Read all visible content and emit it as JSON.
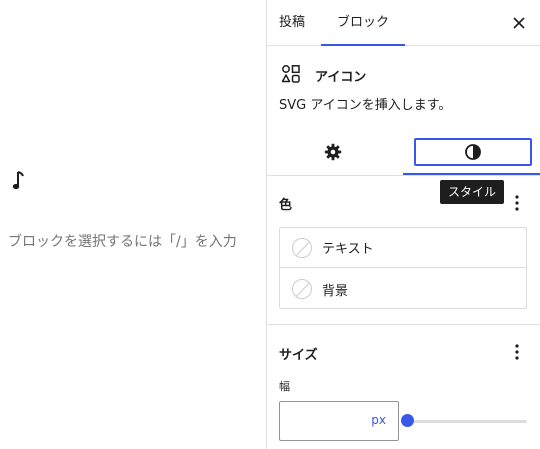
{
  "canvas": {
    "placeholder": "ブロックを選択するには「/」を入力"
  },
  "sidebar": {
    "tabs": [
      {
        "label": "投稿"
      },
      {
        "label": "ブロック"
      }
    ],
    "block": {
      "title": "アイコン",
      "description": "SVG アイコンを挿入します。"
    },
    "tooltip": "スタイル",
    "color": {
      "title": "色",
      "items": [
        {
          "label": "テキスト"
        },
        {
          "label": "背景"
        }
      ]
    },
    "size": {
      "title": "サイズ",
      "width_label": "幅",
      "width_value": "",
      "width_unit": "px",
      "slider_fraction": 0
    }
  },
  "colors": {
    "accent": "#3858e9",
    "border": "#e0e0e0",
    "text": "#1e1e1e"
  },
  "icons": [
    "music-note-icon",
    "close-icon",
    "shapes-icon",
    "gear-icon",
    "contrast-icon",
    "more-vertical-icon"
  ]
}
